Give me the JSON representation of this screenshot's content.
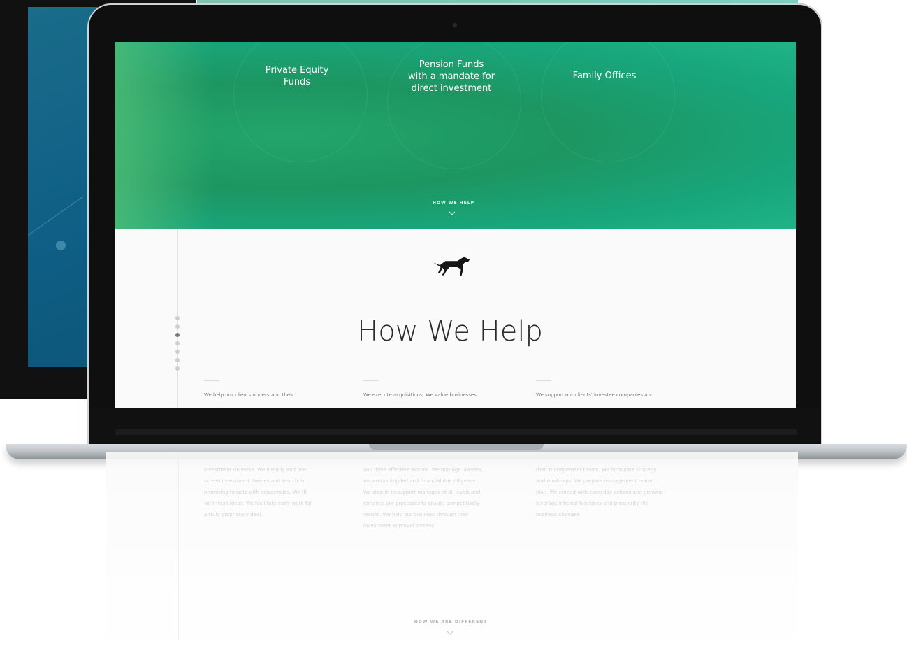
{
  "hero": {
    "items": [
      {
        "label": "Private Equity\nFunds"
      },
      {
        "label": "Pension Funds\nwith a mandate for\ndirect investment"
      },
      {
        "label": "Family Offices"
      }
    ],
    "link": "HOW WE HELP"
  },
  "content": {
    "title": "How We Help",
    "columns": [
      {
        "intro": "We help our clients understand their"
      },
      {
        "intro": "We execute acquisitions. We value businesses."
      },
      {
        "intro": "We support our clients' investee companies and"
      }
    ]
  },
  "fade": {
    "columns": [
      {
        "lines": [
          "investment universe. We identify and pre-",
          "screen investment themes and search for",
          "promising targets with adjacencies. We fill",
          "with fresh ideas. We facilitate early work for",
          "a truly proprietary deal."
        ]
      },
      {
        "lines": [
          "and drive effective models. We manage lawyers,",
          "understanding-led and financial due diligence.",
          "We step in to support manages at all levels and",
          "enhance our processes to ensure competitively",
          "results. We help our business through their",
          "investment approval process."
        ]
      },
      {
        "lines": [
          "their management teams. We formulate strategy",
          "and roadmaps. We prepare management teams'",
          "plan. We embed with everyday actions and growing",
          "leverage internal functions and prosperity the",
          "business changes."
        ]
      }
    ],
    "link": "HOW WE ARE DIFFERENT"
  },
  "icons": {
    "dog": "pointer-dog-icon",
    "chevron": "chevron-down-icon"
  },
  "colors": {
    "hero_green": "#1d9662",
    "title_text": "#2b2b2b",
    "bg_blue": "#0f5f86"
  },
  "pagination": {
    "total": 7,
    "active": 3
  }
}
